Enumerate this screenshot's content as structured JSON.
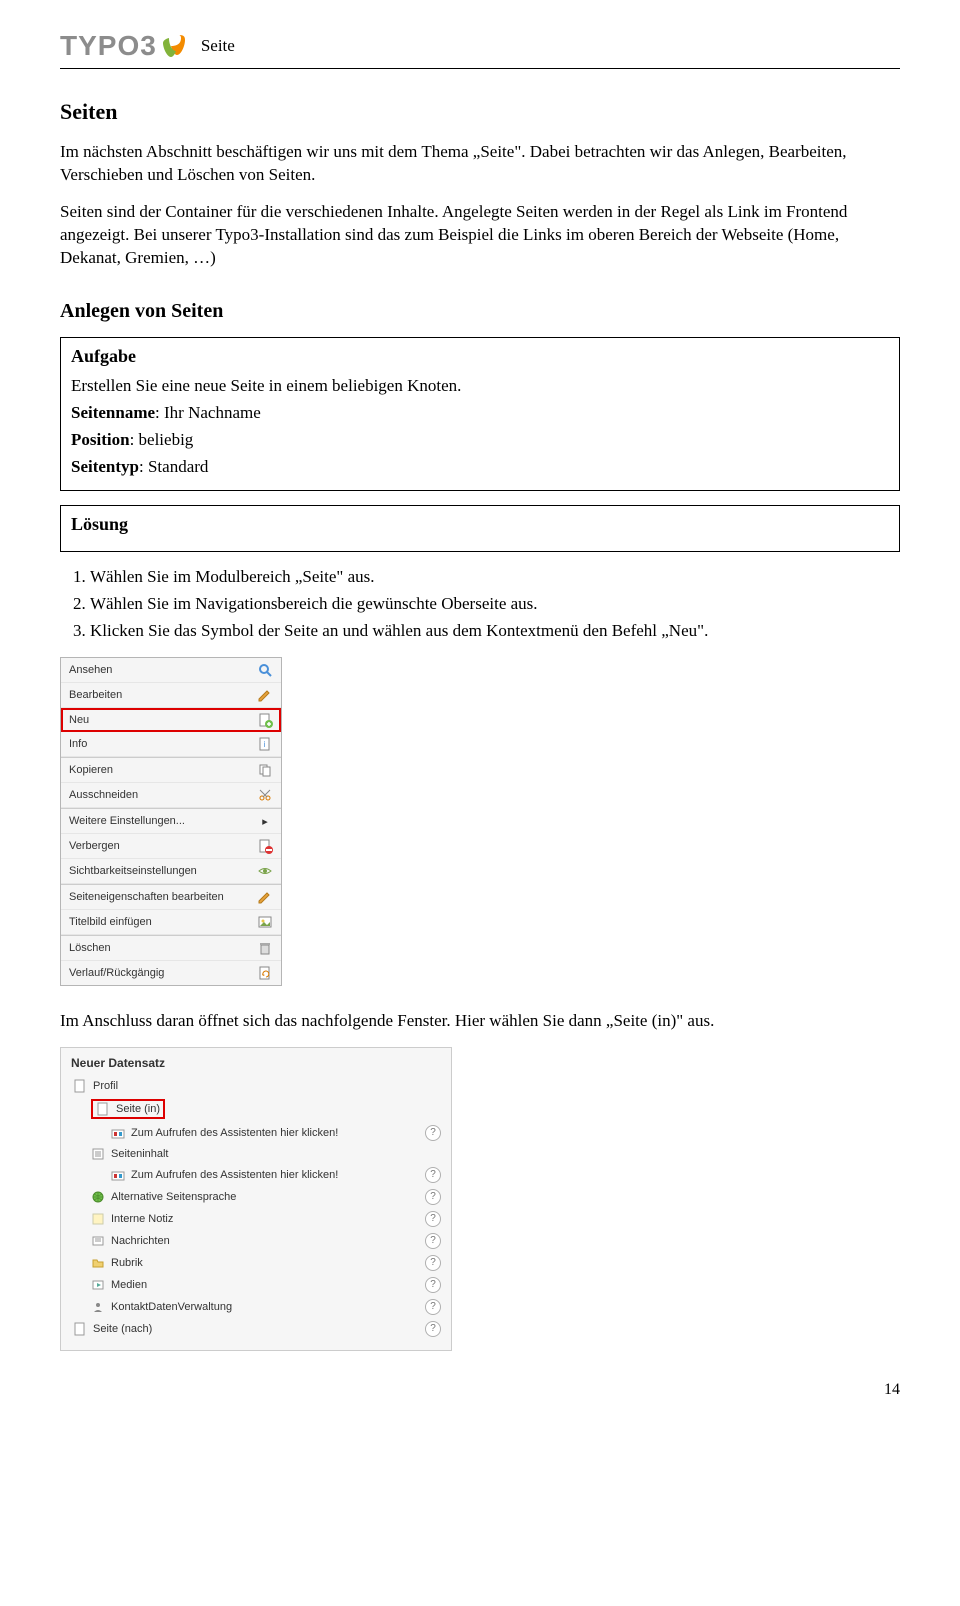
{
  "header": {
    "logo_text": "TYPO3",
    "page_label": "Seite"
  },
  "section_title": "Seiten",
  "intro_p1": "Im nächsten Abschnitt beschäftigen wir uns mit dem Thema „Seite\". Dabei betrachten wir das Anlegen, Bearbeiten, Verschieben und Löschen von Seiten.",
  "intro_p2": "Seiten sind der Container für die verschiedenen Inhalte. Angelegte Seiten werden in der Regel als Link im Frontend angezeigt. Bei unserer Typo3-Installation sind das zum Beispiel die Links im oberen Bereich der Webseite (Home, Dekanat, Gremien, …)",
  "subheading": "Anlegen von Seiten",
  "aufgabe": {
    "title": "Aufgabe",
    "line1": "Erstellen Sie eine neue Seite in einem beliebigen Knoten.",
    "line2a": "Seitenname",
    "line2b": ": Ihr Nachname",
    "line3a": "Position",
    "line3b": ": beliebig",
    "line4a": "Seitentyp",
    "line4b": ": Standard"
  },
  "loesung": {
    "title": "Lösung",
    "steps": [
      "Wählen Sie im Modulbereich „Seite\" aus.",
      "Wählen Sie im Navigationsbereich die gewünschte Oberseite aus.",
      "Klicken Sie das Symbol der Seite an und wählen aus dem Kontextmenü den Befehl „Neu\"."
    ]
  },
  "contextmenu": {
    "items": [
      {
        "label": "Ansehen",
        "icon": "magnifier-icon"
      },
      {
        "label": "Bearbeiten",
        "icon": "pencil-icon"
      },
      {
        "label": "Neu",
        "icon": "page-new-icon",
        "highlighted": true
      },
      {
        "label": "Info",
        "icon": "info-icon"
      },
      {
        "label": "Kopieren",
        "icon": "copy-icon"
      },
      {
        "label": "Ausschneiden",
        "icon": "scissors-icon"
      },
      {
        "label": "Weitere Einstellungen...",
        "icon": ""
      },
      {
        "label": "Verbergen",
        "icon": "hide-icon"
      },
      {
        "label": "Sichtbarkeitseinstellungen",
        "icon": "visibility-icon"
      },
      {
        "label": "Seiteneigenschaften bearbeiten",
        "icon": "pencil-icon"
      },
      {
        "label": "Titelbild einfügen",
        "icon": "image-icon"
      },
      {
        "label": "Löschen",
        "icon": "trash-icon"
      },
      {
        "label": "Verlauf/Rückgängig",
        "icon": "history-icon"
      }
    ]
  },
  "after_menu_text": "Im Anschluss daran öffnet sich das nachfolgende Fenster. Hier wählen Sie dann „Seite (in)\" aus.",
  "newrecord": {
    "title": "Neuer Datensatz",
    "items": [
      {
        "label": "Profil",
        "indent": 0,
        "icon": "page-icon",
        "help": false
      },
      {
        "label": "Seite (in)",
        "indent": 1,
        "icon": "page-icon",
        "help": false,
        "highlighted": true
      },
      {
        "label": "Zum Aufrufen des Assistenten hier klicken!",
        "indent": 2,
        "icon": "wizard-icon",
        "help": true
      },
      {
        "label": "Seiteninhalt",
        "indent": 1,
        "icon": "content-icon",
        "help": false
      },
      {
        "label": "Zum Aufrufen des Assistenten hier klicken!",
        "indent": 2,
        "icon": "wizard-icon",
        "help": true
      },
      {
        "label": "Alternative Seitensprache",
        "indent": 1,
        "icon": "language-icon",
        "help": true
      },
      {
        "label": "Interne Notiz",
        "indent": 1,
        "icon": "note-icon",
        "help": true
      },
      {
        "label": "Nachrichten",
        "indent": 1,
        "icon": "news-icon",
        "help": true
      },
      {
        "label": "Rubrik",
        "indent": 1,
        "icon": "folder-icon",
        "help": true
      },
      {
        "label": "Medien",
        "indent": 1,
        "icon": "media-icon",
        "help": true
      },
      {
        "label": "KontaktDatenVerwaltung",
        "indent": 1,
        "icon": "contact-icon",
        "help": true
      },
      {
        "label": "Seite (nach)",
        "indent": 0,
        "icon": "page-icon",
        "help": true
      }
    ]
  },
  "page_number": "14"
}
